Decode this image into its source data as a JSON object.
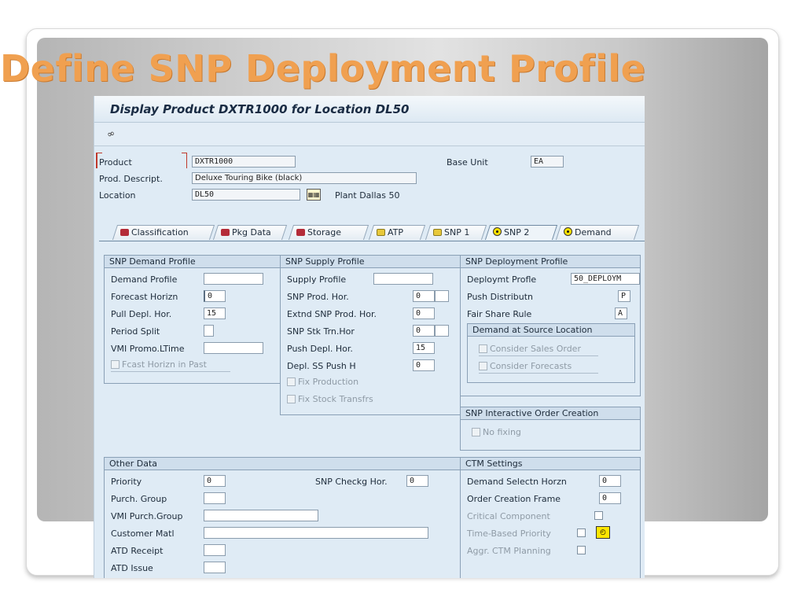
{
  "slide": {
    "title": "Define SNP Deployment Profile"
  },
  "window": {
    "title": "Display Product DXTR1000 for Location DL50"
  },
  "toolbar": {
    "icon": "glasses-icon"
  },
  "header": {
    "product_label": "Product",
    "product_value": "DXTR1000",
    "base_unit_label": "Base Unit",
    "base_unit_value": "EA",
    "desc_label": "Prod. Descript.",
    "desc_value": "Deluxe Touring Bike (black)",
    "location_label": "Location",
    "location_value": "DL50",
    "location_name": "Plant Dallas 50"
  },
  "tabs": [
    {
      "label": "Classification",
      "icon": "red"
    },
    {
      "label": "Pkg Data",
      "icon": "red"
    },
    {
      "label": "Storage",
      "icon": "red"
    },
    {
      "label": "ATP",
      "icon": "yellow"
    },
    {
      "label": "SNP 1",
      "icon": "yellow"
    },
    {
      "label": "SNP 2",
      "icon": "radio",
      "active": true
    },
    {
      "label": "Demand",
      "icon": "radio"
    }
  ],
  "demand_profile": {
    "title": "SNP Demand Profile",
    "demand_profile_label": "Demand Profile",
    "demand_profile_value": "",
    "forecast_horizon_label": "Forecast Horizn",
    "forecast_horizon_value": "0",
    "pull_depl_label": "Pull Depl. Hor.",
    "pull_depl_value": "15",
    "period_split_label": "Period Split",
    "period_split_value": "",
    "vmi_promo_label": "VMI Promo.LTime",
    "vmi_promo_value": "",
    "fcast_past_label": "Fcast Horizn in Past"
  },
  "supply_profile": {
    "title": "SNP Supply Profile",
    "supply_profile_label": "Supply Profile",
    "supply_profile_value": "",
    "snp_prod_hor_label": "SNP Prod. Hor.",
    "snp_prod_hor_value": "0",
    "extnd_snp_label": "Extnd SNP Prod. Hor.",
    "extnd_snp_value": "0",
    "snp_stk_label": "SNP Stk Trn.Hor",
    "snp_stk_value": "0",
    "push_depl_label": "Push Depl. Hor.",
    "push_depl_value": "15",
    "depl_ss_label": "Depl. SS Push H",
    "depl_ss_value": "0",
    "fix_production_label": "Fix Production",
    "fix_stock_label": "Fix Stock Transfrs"
  },
  "deployment_profile": {
    "title": "SNP Deployment Profile",
    "deploy_profile_label": "Deploymt Profle",
    "deploy_profile_value": "50_DEPLOYM",
    "push_dist_label": "Push Distributn",
    "push_dist_value": "P",
    "fair_share_label": "Fair Share Rule",
    "fair_share_value": "A",
    "demand_source_title": "Demand at Source Location",
    "consider_sales_label": "Consider Sales Order",
    "consider_forecasts_label": "Consider Forecasts"
  },
  "interactive": {
    "title": "SNP Interactive Order Creation",
    "no_fixing_label": "No fixing"
  },
  "other_data": {
    "title": "Other Data",
    "priority_label": "Priority",
    "priority_value": "0",
    "snp_checkg_label": "SNP Checkg Hor.",
    "snp_checkg_value": "0",
    "purch_group_label": "Purch. Group",
    "purch_group_value": "",
    "vmi_purch_label": "VMI Purch.Group",
    "vmi_purch_value": "",
    "customer_matl_label": "Customer Matl",
    "customer_matl_value": "",
    "atd_receipt_label": "ATD Receipt",
    "atd_receipt_value": "",
    "atd_issue_label": "ATD Issue",
    "atd_issue_value": ""
  },
  "ctm": {
    "title": "CTM Settings",
    "demand_sel_label": "Demand Selectn Horzn",
    "demand_sel_value": "0",
    "order_creation_label": "Order Creation Frame",
    "order_creation_value": "0",
    "critical_label": "Critical Component",
    "time_based_label": "Time-Based Priority",
    "aggr_label": "Aggr. CTM Planning"
  }
}
